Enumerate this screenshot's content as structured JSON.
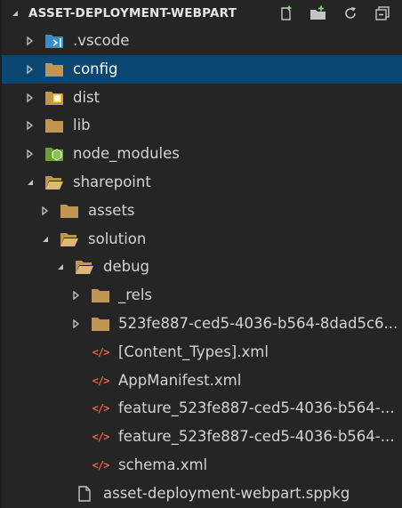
{
  "explorer": {
    "title": "ASSET-DEPLOYMENT-WEBPART",
    "actions": {
      "new_file": "new-file-icon",
      "new_folder": "new-folder-icon",
      "refresh": "refresh-icon",
      "collapse_all": "collapse-all-icon"
    },
    "items": [
      {
        "label": ".vscode",
        "icon": "vscode-folder-icon",
        "expanded": false
      },
      {
        "label": "config",
        "icon": "folder-icon",
        "expanded": false,
        "selected": true
      },
      {
        "label": "dist",
        "icon": "dist-folder-icon",
        "expanded": false
      },
      {
        "label": "lib",
        "icon": "folder-icon",
        "expanded": false
      },
      {
        "label": "node_modules",
        "icon": "node-folder-icon",
        "expanded": false
      },
      {
        "label": "sharepoint",
        "icon": "folder-open-icon",
        "expanded": true
      },
      {
        "label": "assets",
        "icon": "folder-icon",
        "expanded": false
      },
      {
        "label": "solution",
        "icon": "folder-open-icon",
        "expanded": true
      },
      {
        "label": "debug",
        "icon": "folder-open-icon",
        "expanded": true
      },
      {
        "label": "_rels",
        "icon": "folder-icon",
        "expanded": false
      },
      {
        "label": "523fe887-ced5-4036-b564-8dad5c6...",
        "icon": "folder-icon",
        "expanded": false
      },
      {
        "label": "[Content_Types].xml",
        "icon": "xml-icon"
      },
      {
        "label": "AppManifest.xml",
        "icon": "xml-icon"
      },
      {
        "label": "feature_523fe887-ced5-4036-b564-...",
        "icon": "xml-icon"
      },
      {
        "label": "feature_523fe887-ced5-4036-b564-...",
        "icon": "xml-icon"
      },
      {
        "label": "schema.xml",
        "icon": "xml-icon"
      },
      {
        "label": "asset-deployment-webpart.sppkg",
        "icon": "file-icon"
      }
    ]
  },
  "colors": {
    "background": "#252526",
    "selection": "#094771",
    "folder": "#c09553",
    "xml": "#e8633a"
  }
}
